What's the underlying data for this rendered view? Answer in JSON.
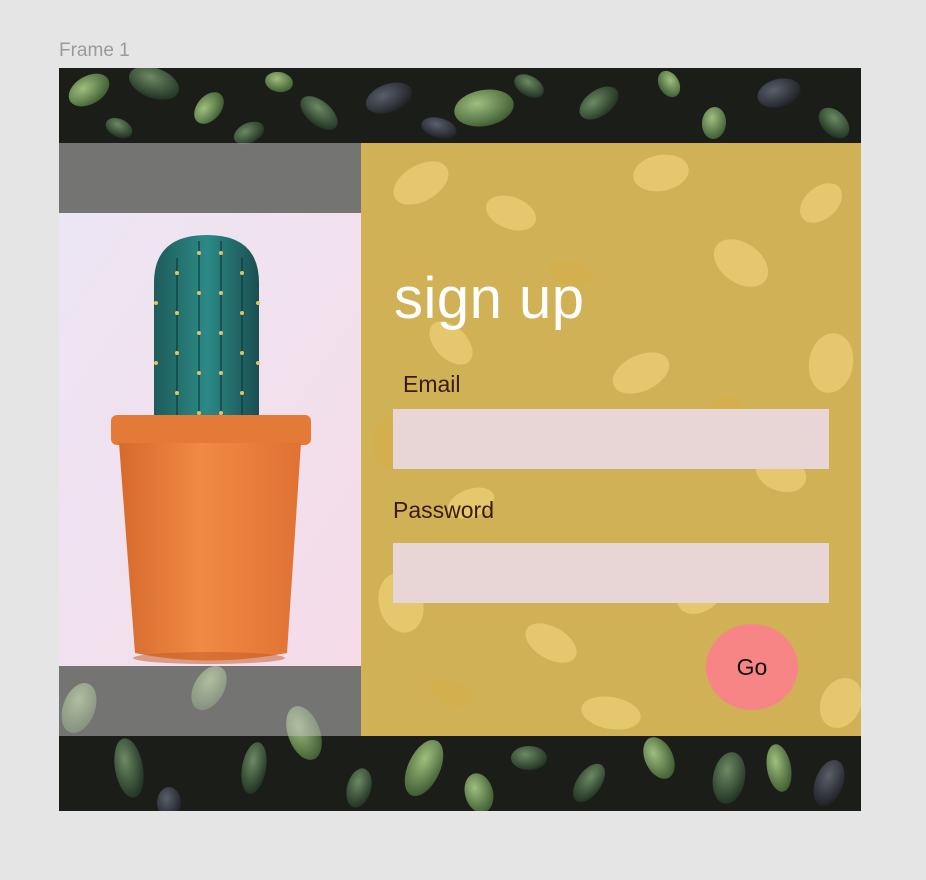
{
  "frame": {
    "label": "Frame 1"
  },
  "form": {
    "title": "sign up",
    "email_label": "Email",
    "email_value": "",
    "email_placeholder": "",
    "password_label": "Password",
    "password_value": "",
    "password_placeholder": "",
    "submit_label": "Go"
  },
  "colors": {
    "canvas": "#e5e5e5",
    "panel_yellow": "#f0ca60",
    "field_fill": "#e8d6d6",
    "button_fill": "#f88585",
    "label_text": "#3b1a12",
    "title_text": "#ffffff"
  }
}
